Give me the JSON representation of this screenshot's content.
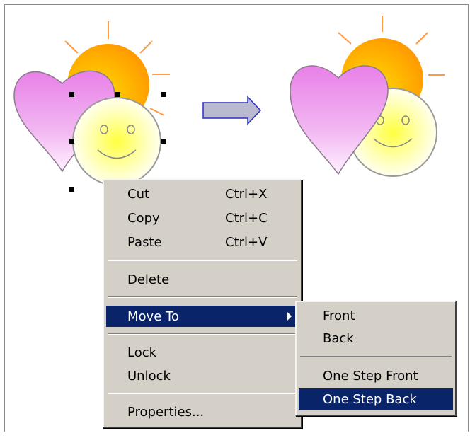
{
  "context_menu": {
    "items": [
      {
        "label": "Cut",
        "shortcut": "Ctrl+X"
      },
      {
        "label": "Copy",
        "shortcut": "Ctrl+C"
      },
      {
        "label": "Paste",
        "shortcut": "Ctrl+V"
      },
      {
        "label": "Delete"
      },
      {
        "label": "Move To",
        "selected": true,
        "has_submenu": true
      },
      {
        "label": "Lock"
      },
      {
        "label": "Unlock"
      },
      {
        "label": "Properties..."
      }
    ]
  },
  "submenu": {
    "items": [
      {
        "label": "Front"
      },
      {
        "label": "Back"
      },
      {
        "label": "One Step Front"
      },
      {
        "label": "One Step Back",
        "selected": true
      }
    ]
  },
  "colors": {
    "menu_bg": "#d4d0c8",
    "selection": "#0a246a",
    "sun": "#ffb000",
    "heart": "#e88ee8",
    "smiley": "#fffaa0",
    "arrow": "#b9b9cf"
  },
  "shapes": [
    "sun",
    "heart",
    "smiley-face",
    "arrow"
  ]
}
